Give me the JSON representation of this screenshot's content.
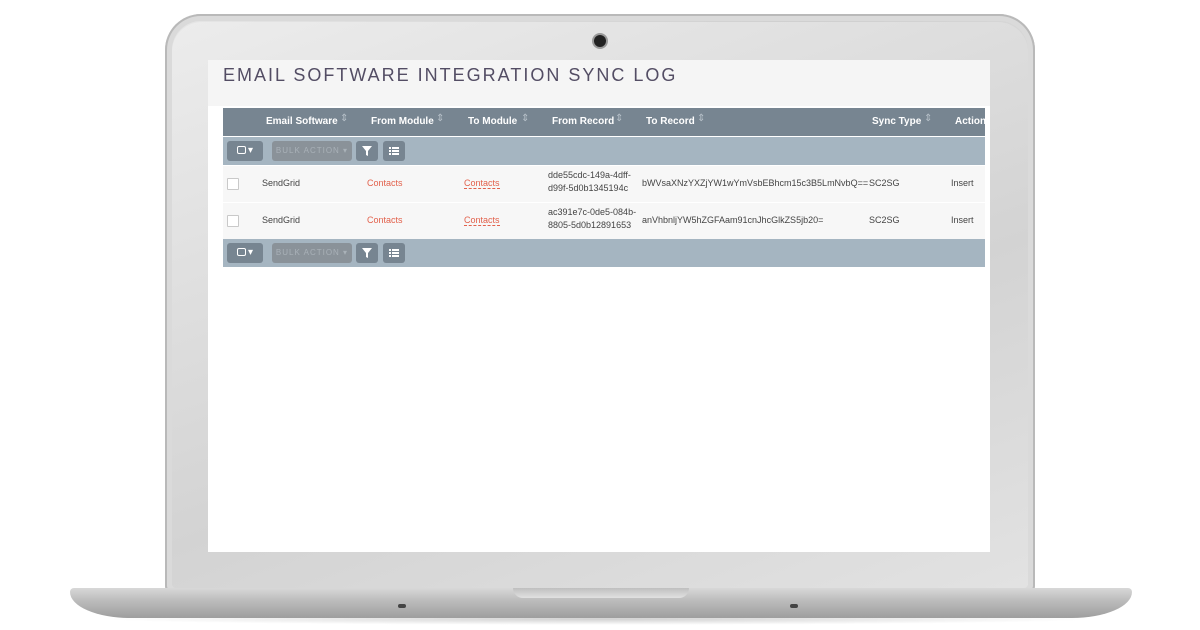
{
  "page": {
    "title": "EMAIL SOFTWARE INTEGRATION SYNC LOG"
  },
  "table": {
    "columns": [
      "Email Software",
      "From Module",
      "To Module",
      "From Record",
      "To Record",
      "Sync Type",
      "Action"
    ],
    "rows": [
      {
        "email_software": "SendGrid",
        "from_module": "Contacts",
        "to_module": "Contacts",
        "from_record_line1": "dde55cdc-149a-4dff-",
        "from_record_line2": "d99f-5d0b1345194c",
        "to_record": "bWVsaXNzYXZjYW1wYmVsbEBhcm15c3B5LmNvbQ==",
        "sync_type": "SC2SG",
        "action": "Insert"
      },
      {
        "email_software": "SendGrid",
        "from_module": "Contacts",
        "to_module": "Contacts",
        "from_record_line1": "ac391e7c-0de5-084b-",
        "from_record_line2": "8805-5d0b12891653",
        "to_record": "anVhbnljYW5hZGFAam91cnJhcGlkZS5jb20=",
        "sync_type": "SC2SG",
        "action": "Insert"
      }
    ]
  },
  "actions": {
    "bulk_label": "BULK ACTION ▾",
    "select_caret": "▾",
    "filter_icon": "filter-icon",
    "columns_icon": "columns-icon"
  },
  "colors": {
    "header_bg": "#778591",
    "actionbar_bg": "#a5b5c1",
    "link": "#e2614c",
    "title": "#534d64"
  }
}
